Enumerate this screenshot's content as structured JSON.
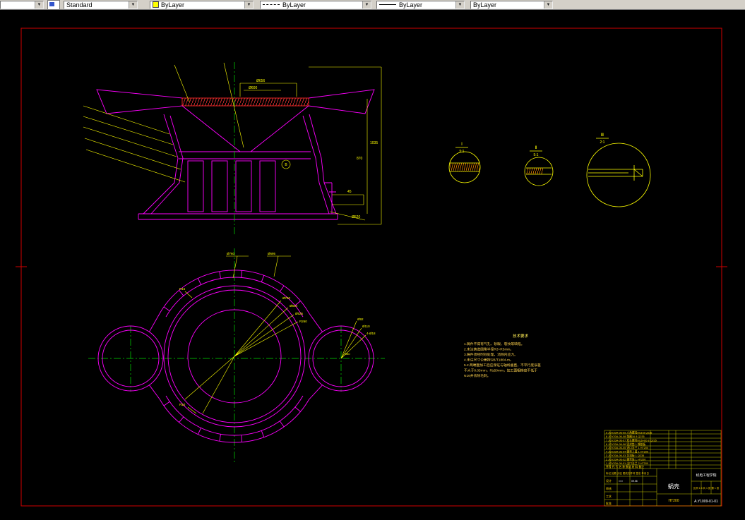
{
  "toolbar": {
    "style_label": "Standard",
    "color_label": "ByLayer",
    "linetype_label": "ByLayer",
    "lineweight_label": "ByLayer",
    "plotstyle_label": "ByLayer"
  },
  "drawing": {
    "details": {
      "d1": "Ⅰ",
      "d1s": "5:1",
      "d2": "Ⅱ",
      "d2s": "5:1",
      "d3": "Ⅲ",
      "d3s": "2:1"
    },
    "side_dims": {
      "dim_top1": "Ø656",
      "dim_top2": "Ø600",
      "dim_right1": "1035",
      "dim_right2": "870",
      "dim_br1": "45",
      "dim_br2": "Ø520",
      "detail_marker": "B"
    },
    "plan_dims": {
      "fan1": "Ø750",
      "fan2": "Ø640",
      "fan3": "Ø525",
      "fan4": "R260",
      "right1": "Ø92",
      "right2": "Ø110",
      "right3": "4-Ø18",
      "top1": "Ø760",
      "top2": "Ø695",
      "left1": "R15",
      "bottom1": "R10",
      "rc": "Ø80"
    },
    "notes": {
      "title": "技术要求",
      "lines": [
        "1.铸件不得有气孔、砂眼、裂纹等缺陷。",
        "2.未注铸造圆角半径R3~R5mm。",
        "3.铸件须经时效处理，消除内应力。",
        "4.未注尺寸公差按GB/T1804-m。",
        "5.2.两端面加工后应保证与轴线垂直，不平行度误差",
        "  不大于0.05mm，R≥50mm，加工面粗糙度不低于",
        "  N16并去除毛刺。"
      ]
    }
  },
  "title_block": {
    "parts_rows": [
      "9  JGY20A-06-09  六角螺母M16  8  Q235",
      "8  JGY20A-06-08  垫圈16  8  Q235",
      "7  JGY20A-06-07  双头螺柱M16×60  8  Q235",
      "6  JGY20A-06-06  密封垫  1  橡胶板",
      "5  JGY20A-06-05  进口法兰  1  HT200",
      "4  JGY20A-06-04  蜗壳上盖  1  HT200",
      "3  JGY20A-06-03  导流板  1  Q235",
      "2  JGY20A-06-02  蜗壳体  1  HT200",
      "1  JGY20A-06-01  出口法兰  2  HT200"
    ],
    "parts_header": "序号  代  号  名  称  数量  材 料  备注",
    "row_sign": "标记 处数 分区 更改文件号 签名 年月日",
    "left_rows": [
      "设计",
      "审核",
      "工艺",
      "批准"
    ],
    "designer": "×××",
    "date": "09.06",
    "part_name": "蜗壳",
    "material": "HT200",
    "scale_row": "比例 1:5  共 1 张 第 1 张",
    "org": "机电工程学院",
    "drawing_no": "A.Y1009-01-01"
  }
}
